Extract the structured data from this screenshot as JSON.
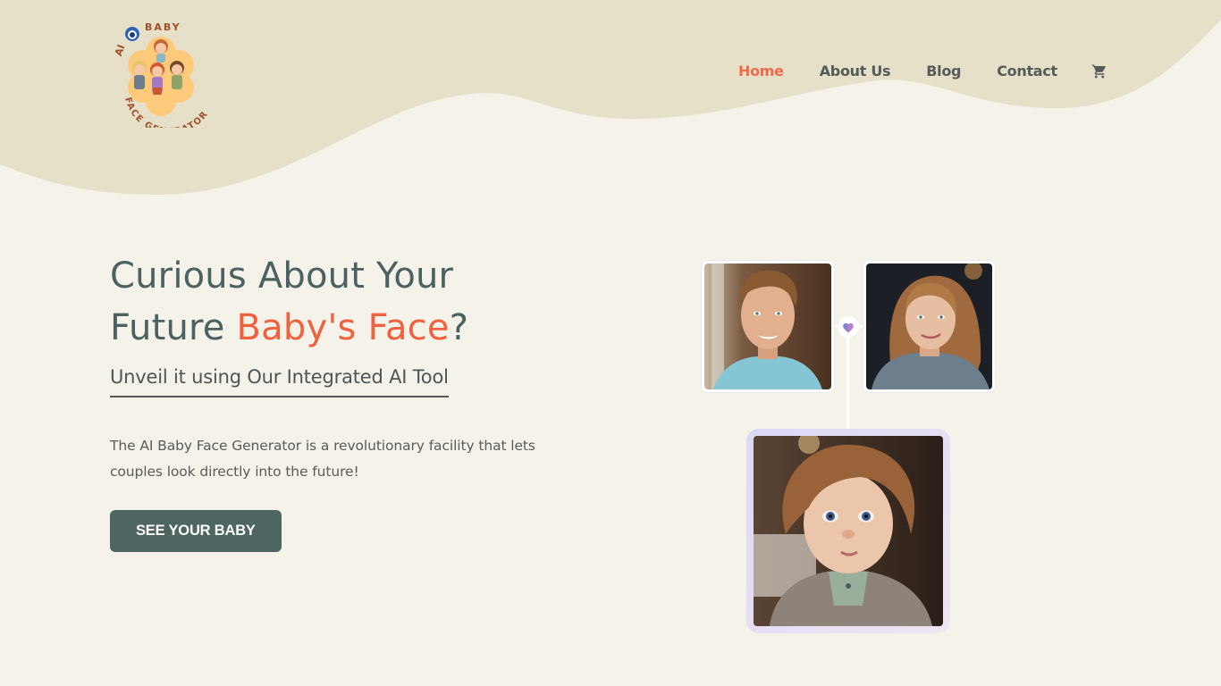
{
  "brand": {
    "logo_top_text": "AI BABY",
    "logo_bottom_text": "FACE GENERATOR",
    "logo_icon": "robot-icon"
  },
  "nav": {
    "items": [
      {
        "label": "Home",
        "active": true
      },
      {
        "label": "About Us",
        "active": false
      },
      {
        "label": "Blog",
        "active": false
      },
      {
        "label": "Contact",
        "active": false
      }
    ],
    "cart_icon": "cart-icon"
  },
  "hero": {
    "headline_line1": "Curious About Your",
    "headline_line2_prefix": "Future ",
    "headline_accent": "Baby's Face",
    "headline_suffix": "?",
    "subheading": "Unveil it using Our Integrated AI Tool",
    "description": "The AI Baby Face Generator is a revolutionary facility that lets couples look directly into the future!",
    "cta_label": "SEE YOUR BABY"
  },
  "illustration": {
    "parent1_alt": "Young man portrait",
    "parent2_alt": "Young woman portrait",
    "child_alt": "Toddler portrait",
    "connector_icon": "heart-icon"
  },
  "colors": {
    "accent": "#f0613e",
    "primary": "#4e6562",
    "background": "#f5f2ea",
    "header_wave": "#e7e0c9"
  }
}
